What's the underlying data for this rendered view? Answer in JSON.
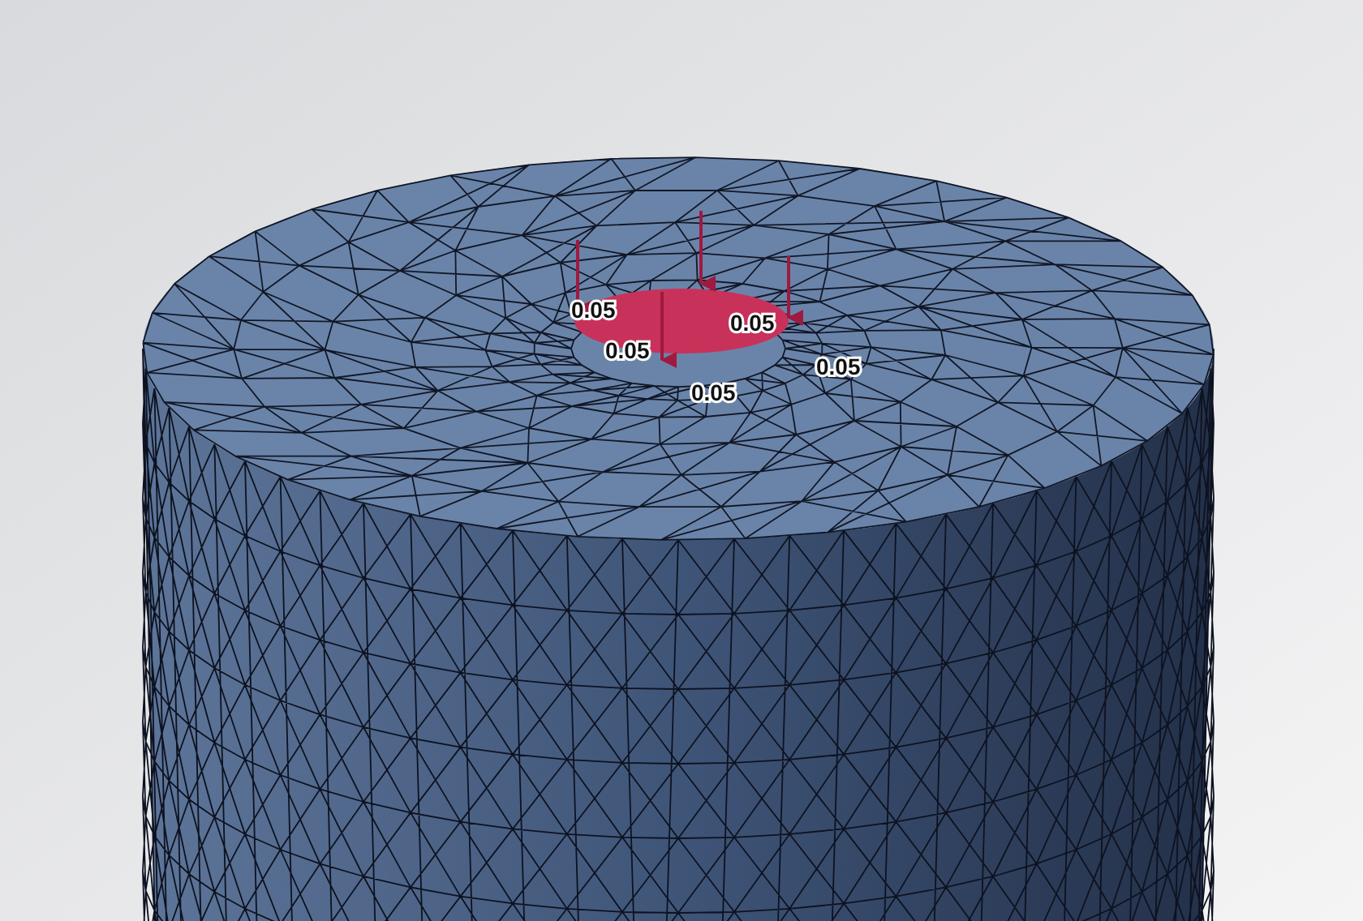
{
  "viewport": {
    "load_labels": [
      "0.05",
      "0.05",
      "0.05",
      "0.05",
      "0.05"
    ]
  }
}
